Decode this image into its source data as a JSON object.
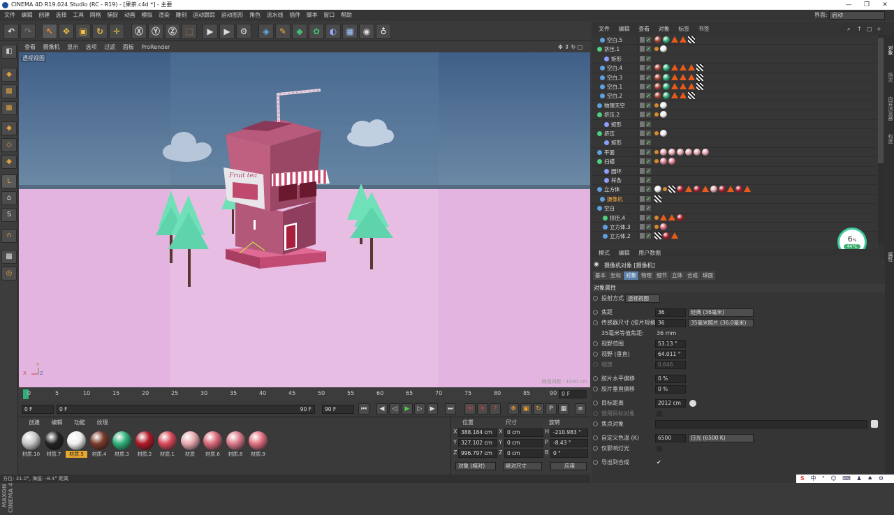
{
  "titlebar": {
    "title": "CINEMA 4D R19.024 Studio (RC - R19) - [果茶.c4d *] - 主要"
  },
  "menubar": {
    "items": [
      "文件",
      "编辑",
      "创建",
      "选择",
      "工具",
      "网格",
      "捕捉",
      "动画",
      "模拟",
      "渲染",
      "雕刻",
      "运动跟踪",
      "运动图形",
      "角色",
      "流水线",
      "插件",
      "脚本",
      "窗口",
      "帮助"
    ],
    "layout_label": "界面:",
    "layout_value": "启动"
  },
  "viewport": {
    "menu": [
      "查看",
      "摄像机",
      "显示",
      "选项",
      "过滤",
      "面板",
      "ProRender"
    ],
    "label": "透视视图",
    "scale": "网格间距 : 1000 cm",
    "sign_text": "Fruit tea"
  },
  "timeline": {
    "ticks": [
      "0",
      "5",
      "10",
      "15",
      "20",
      "25",
      "30",
      "35",
      "40",
      "45",
      "50",
      "55",
      "60",
      "65",
      "70",
      "75",
      "80",
      "85",
      "90"
    ],
    "end_frame": "0 F"
  },
  "playbar": {
    "start": "0 F",
    "range_start": "0 F",
    "range_end": "90 F",
    "end": "90 F"
  },
  "materials": {
    "menu": [
      "创建",
      "编辑",
      "功能",
      "纹理"
    ],
    "items": [
      {
        "label": "材质.10",
        "color": "#c8c8c8"
      },
      {
        "label": "材质.7",
        "color": "#222"
      },
      {
        "label": "材质.5",
        "color": "#f0f0f0",
        "selected": true
      },
      {
        "label": "材质.4",
        "color": "#7a3a2a"
      },
      {
        "label": "材质.3",
        "color": "#2fb07a"
      },
      {
        "label": "材质.2",
        "color": "#b01828"
      },
      {
        "label": "材质.1",
        "color": "#d8485a"
      },
      {
        "label": "材质",
        "color": "#e8a8b0"
      },
      {
        "label": "材质.6",
        "color": "#d86878"
      },
      {
        "label": "材质.8",
        "color": "#d87888"
      },
      {
        "label": "材质.9",
        "color": "#e07080"
      }
    ]
  },
  "coords": {
    "headers": [
      "位置",
      "尺寸",
      "旋转"
    ],
    "rows": [
      {
        "axis": "X",
        "pos": "388.184 cm",
        "size": "0 cm",
        "rlabel": "H",
        "rot": "-210.983 °"
      },
      {
        "axis": "Y",
        "pos": "327.102 cm",
        "size": "0 cm",
        "rlabel": "P",
        "rot": "-8.43 °"
      },
      {
        "axis": "Z",
        "pos": "996.797 cm",
        "size": "0 cm",
        "rlabel": "B",
        "rot": "0 °"
      }
    ],
    "mode": "对象 (相对)",
    "size_mode": "绝对尺寸",
    "apply": "应用"
  },
  "status": "方位: 31.0°, 海拔: -8.4°  距离",
  "brand": "MAXON CINEMA 4D",
  "objects": {
    "menu": [
      "文件",
      "编辑",
      "查看",
      "对象",
      "标签",
      "书签"
    ],
    "rows": [
      {
        "name": "空白.5",
        "tags": [
          "c:#a04030",
          "c:#2fb07a",
          "t",
          "t",
          "k"
        ]
      },
      {
        "name": "挤压.1",
        "tags": [
          "d",
          "c:#f0f0f0"
        ]
      },
      {
        "name": "矩形",
        "tags": []
      },
      {
        "name": "空白.4",
        "tags": [
          "c:#a04030",
          "c:#2fb07a",
          "t",
          "t",
          "t",
          "k"
        ]
      },
      {
        "name": "空白.3",
        "tags": [
          "c:#a04030",
          "c:#2fb07a",
          "t",
          "t",
          "t",
          "k"
        ]
      },
      {
        "name": "空白.1",
        "tags": [
          "c:#a04030",
          "c:#2fb07a",
          "t",
          "t",
          "t",
          "k"
        ]
      },
      {
        "name": "空白.2",
        "tags": [
          "c:#a04030",
          "c:#2fb07a",
          "t",
          "t",
          "k"
        ]
      },
      {
        "name": "物理天空",
        "tags": [
          "d",
          "c:#f0f0f0"
        ]
      },
      {
        "name": "挤压.2",
        "tags": [
          "d",
          "c:#f0f0f0"
        ]
      },
      {
        "name": "矩形",
        "tags": []
      },
      {
        "name": "挤压",
        "tags": [
          "d",
          "c:#f0f0f0"
        ]
      },
      {
        "name": "矩形",
        "tags": []
      },
      {
        "name": "平面",
        "tags": [
          "d",
          "c:#e8a8b0",
          "c:#e8a8b0",
          "c:#e8a8b0",
          "c:#e8a8b0",
          "c:#e8a8b0",
          "c:#e8a8b0"
        ]
      },
      {
        "name": "扫描",
        "tags": [
          "d",
          "c:#e08090",
          "c:#e08090"
        ]
      },
      {
        "name": "圆环",
        "tags": []
      },
      {
        "name": "样条",
        "tags": []
      },
      {
        "name": "立方体",
        "tags": [
          "c:#f0f0f0",
          "d",
          "k",
          "c:#b01828",
          "t",
          "c:#b01828",
          "t",
          "c:#e8a8b0",
          "c:#b01828",
          "t",
          "c:#b01828",
          "t"
        ]
      },
      {
        "name": "摄像机",
        "tags": [
          "k"
        ],
        "selected": true
      },
      {
        "name": "空白",
        "tags": []
      },
      {
        "name": "挤压.4",
        "tags": [
          "d",
          "t",
          "t",
          "c:#b01828"
        ]
      },
      {
        "name": "立方体.3",
        "tags": [
          "d",
          "c:#d86878"
        ]
      },
      {
        "name": "立方体.2",
        "tags": [
          "k",
          "c:#b01828",
          "t"
        ]
      }
    ]
  },
  "attributes": {
    "menu": [
      "模式",
      "编辑",
      "用户数据"
    ],
    "title": "摄像机对象 [摄像机]",
    "tabs": [
      {
        "label": "基本"
      },
      {
        "label": "坐标"
      },
      {
        "label": "对象",
        "active": true
      },
      {
        "label": "物理"
      },
      {
        "label": "细节"
      },
      {
        "label": "立体"
      },
      {
        "label": "合成"
      },
      {
        "label": "球面"
      }
    ],
    "section": "对象属性",
    "projection_label": "投射方式",
    "projection_value": "透视视图",
    "focal_label": "焦距",
    "focal_value": "36",
    "focal_preset": "经典 (36毫米)",
    "sensor_label": "传感器尺寸 (胶片规格)",
    "sensor_value": "36",
    "sensor_preset": "35毫米照片 (36.0毫米)",
    "equiv_label": "35毫米等值焦距:",
    "equiv_value": "36 mm",
    "fov_label": "视野范围",
    "fov_value": "53.13 °",
    "fovv_label": "视野 (垂直)",
    "fovv_value": "64.011 °",
    "zoom_label": "缩放",
    "zoom_value": "0.646",
    "offx_label": "胶片水平偏移",
    "offx_value": "0 %",
    "offy_label": "胶片垂直偏移",
    "offy_value": "0 %",
    "target_label": "目标距离",
    "target_value": "2012 cm",
    "use_target_label": "使用目标对象",
    "focus_label": "焦点对象",
    "wb_label": "自定义色温 (K)",
    "wb_value": "6500",
    "wb_preset": "日光 (6500 K)",
    "lights_label": "仅影响灯光",
    "export_label": "导出到合成"
  },
  "right_tabs": [
    "对象",
    "场次",
    "内容浏览器",
    "构造"
  ],
  "attr_side_tab": "属性",
  "perf": {
    "value": "6",
    "unit": "%",
    "temp": "44°C"
  },
  "tray": [
    "S",
    "中",
    "°",
    "☺",
    "⌨",
    "♟",
    "♠",
    "⚙"
  ]
}
